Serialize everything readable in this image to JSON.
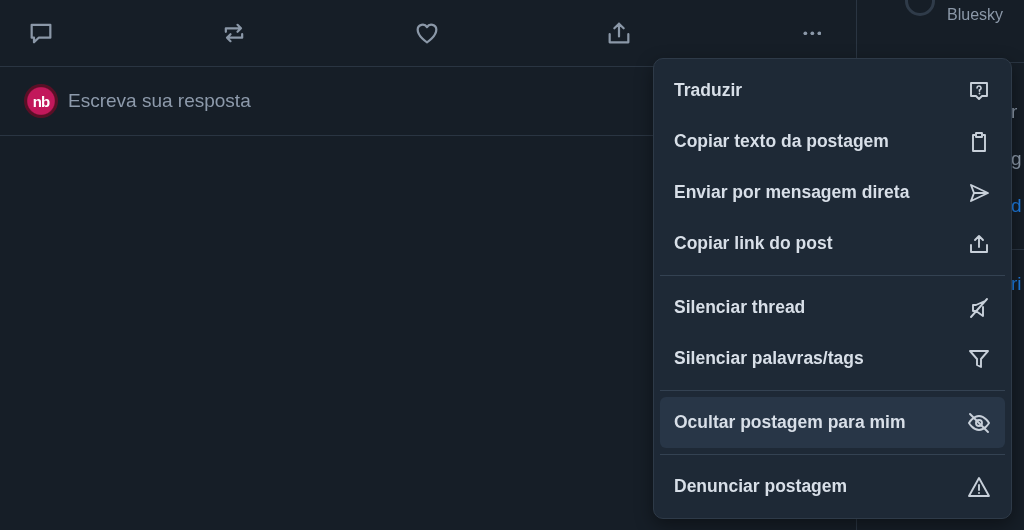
{
  "post_actions": [
    {
      "kind": "reply"
    },
    {
      "kind": "repost"
    },
    {
      "kind": "like"
    },
    {
      "kind": "share"
    },
    {
      "kind": "more"
    }
  ],
  "reply_box": {
    "avatar_text": "nb",
    "placeholder": "Escreva sua resposta"
  },
  "side_column": {
    "top_text": "Bluesky",
    "fragments": [
      {
        "text": "r",
        "kind": "plain"
      },
      {
        "text": "g",
        "kind": "plain"
      },
      {
        "text": "d",
        "kind": "link"
      },
      {
        "text": "ri",
        "kind": "link"
      }
    ]
  },
  "menu": {
    "groups": [
      [
        {
          "label": "Traduzir",
          "kind": "translate",
          "selected": false
        },
        {
          "label": "Copiar texto da postagem",
          "kind": "clipboard",
          "selected": false
        },
        {
          "label": "Enviar por mensagem direta",
          "kind": "send",
          "selected": false
        },
        {
          "label": "Copiar link do post",
          "kind": "share",
          "selected": false
        }
      ],
      [
        {
          "label": "Silenciar thread",
          "kind": "mute",
          "selected": false
        },
        {
          "label": "Silenciar palavras/tags",
          "kind": "filter",
          "selected": false
        }
      ],
      [
        {
          "label": "Ocultar postagem para mim",
          "kind": "hide",
          "selected": true
        }
      ],
      [
        {
          "label": "Denunciar postagem",
          "kind": "warning",
          "selected": false
        }
      ]
    ]
  }
}
